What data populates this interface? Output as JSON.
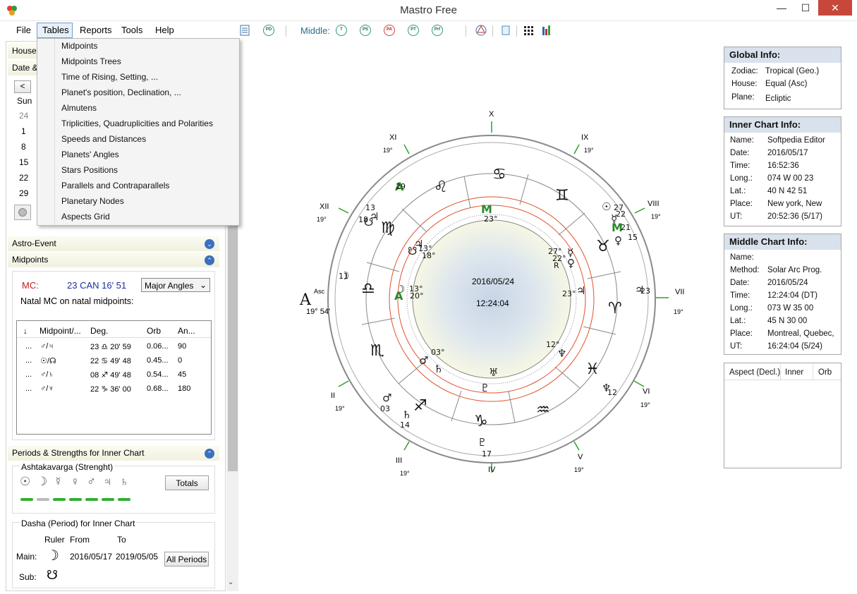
{
  "window": {
    "title": "Mastro Free",
    "minimize": "—",
    "maximize": "☐",
    "close": "✕"
  },
  "menu": {
    "file": "File",
    "tables": "Tables",
    "reports": "Reports",
    "tools": "Tools",
    "help": "Help"
  },
  "toolbar": {
    "middle_label": "Middle:",
    "icons": [
      {
        "label": "PD",
        "name": "pd-chart-icon"
      },
      {
        "label": "T",
        "name": "t-chart-icon"
      },
      {
        "label": "PS",
        "name": "ps-chart-icon"
      },
      {
        "label": "PA",
        "name": "pa-chart-icon"
      },
      {
        "label": "PT",
        "name": "pt-chart-icon"
      },
      {
        "label": "Prf",
        "name": "prf-chart-icon"
      }
    ]
  },
  "tables_menu": [
    "Midpoints",
    "Midpoints Trees",
    "Time of Rising, Setting, ...",
    "Planet's position, Declination, ...",
    "Almutens",
    "Triplicities, Quadruplicities and Polarities",
    "Speeds and Distances",
    "Planets' Angles",
    "Stars Positions",
    "Parallels and Contraparallels",
    "Planetary Nodes",
    "Aspects Grid"
  ],
  "left": {
    "house_label": "House",
    "date_label": "Date &",
    "prev_button": "<",
    "calendar": {
      "day_head": "Sun",
      "days": [
        "24",
        "1",
        "8",
        "15",
        "22",
        "29"
      ]
    },
    "astro_event": "Astro-Event",
    "midpoints": {
      "title": "Midpoints",
      "mc_label": "MC:",
      "mc_value": "23 CAN 16' 51",
      "angles_select": "Major Angles",
      "natal_text": "Natal MC on natal midpoints:",
      "columns": [
        "↓",
        "Midpoint/...",
        "Deg.",
        "Orb",
        "An..."
      ],
      "rows": [
        {
          "c0": "...",
          "c1": "♂/♃",
          "c2": "23 ♎ 20' 59",
          "c3": "0.06...",
          "c4": "90"
        },
        {
          "c0": "...",
          "c1": "☉/☊",
          "c2": "22 ♋ 49' 48",
          "c3": "0.45...",
          "c4": "0"
        },
        {
          "c0": "...",
          "c1": "♂/♄",
          "c2": "08 ♐ 49' 48",
          "c3": "0.54...",
          "c4": "45"
        },
        {
          "c0": "...",
          "c1": "♂/♆",
          "c2": "22 ♑ 36' 00",
          "c3": "0.68...",
          "c4": "180"
        }
      ]
    },
    "periods": {
      "title": "Periods & Strengths  for Inner Chart",
      "ashtakavarga": "Ashtakavarga  (Strenght)",
      "planets": [
        "☉",
        "☽",
        "☿",
        "♀",
        "♂",
        "♃",
        "♄"
      ],
      "totals_button": "Totals",
      "dasha_title": "Dasha (Period) for Inner Chart",
      "ruler": "Ruler",
      "from": "From",
      "to": "To",
      "main_label": "Main:",
      "main_symbol": "☽",
      "main_from": "2016/05/17",
      "main_to": "2019/05/05",
      "all_periods_button": "All Periods",
      "sub_label": "Sub:",
      "sub_symbol": "☋"
    }
  },
  "chart": {
    "center_date": "2016/05/24",
    "center_time": "12:24:04",
    "houses": [
      {
        "label": "X",
        "deg": ""
      },
      {
        "label": "XI",
        "deg": "19°"
      },
      {
        "label": "IX",
        "deg": "19°"
      },
      {
        "label": "XII",
        "deg": "19°"
      },
      {
        "label": "VIII",
        "deg": "19°"
      },
      {
        "label": "VII",
        "deg": "19°"
      },
      {
        "label": "VI",
        "deg": "19°"
      },
      {
        "label": "II",
        "deg": "19°"
      },
      {
        "label": "III",
        "deg": "19°"
      },
      {
        "label": "V",
        "deg": "19°"
      },
      {
        "label": "IV",
        "deg": ""
      }
    ],
    "asc_label": "Asc",
    "asc_deg": "19° 54'",
    "house_deg_inner": "23°"
  },
  "global_info": {
    "title": "Global Info:",
    "rows": [
      {
        "k": "Zodiac:",
        "v": "Tropical (Geo.)"
      },
      {
        "k": "House:",
        "v": "Equal (Asc)"
      },
      {
        "k": "Plane:",
        "v": "Ecliptic"
      }
    ]
  },
  "inner_info": {
    "title": "Inner Chart Info:",
    "rows": [
      {
        "k": "Name:",
        "v": "Softpedia Editor"
      },
      {
        "k": "Date:",
        "v": "2016/05/17"
      },
      {
        "k": "Time:",
        "v": "16:52:36"
      },
      {
        "k": "Long.:",
        "v": "074 W 00 23"
      },
      {
        "k": "Lat.:",
        "v": "40 N 42 51"
      },
      {
        "k": "Place:",
        "v": "New york, New"
      },
      {
        "k": "UT:",
        "v": "20:52:36 (5/17)"
      }
    ]
  },
  "middle_info": {
    "title": "Middle Chart Info:",
    "rows": [
      {
        "k": "Name:",
        "v": ""
      },
      {
        "k": "Method:",
        "v": "Solar Arc Prog."
      },
      {
        "k": "Date:",
        "v": "2016/05/24"
      },
      {
        "k": "Time:",
        "v": "12:24:04  (DT)"
      },
      {
        "k": "Long.:",
        "v": "073 W 35 00"
      },
      {
        "k": "Lat.:",
        "v": "45 N 30 00"
      },
      {
        "k": "Place:",
        "v": "Montreal, Quebec,"
      },
      {
        "k": "UT:",
        "v": "16:24:04 (5/24)"
      }
    ]
  },
  "aspect_table": {
    "columns": [
      "Aspect (Decl.)",
      "Inner",
      "Orb"
    ]
  }
}
